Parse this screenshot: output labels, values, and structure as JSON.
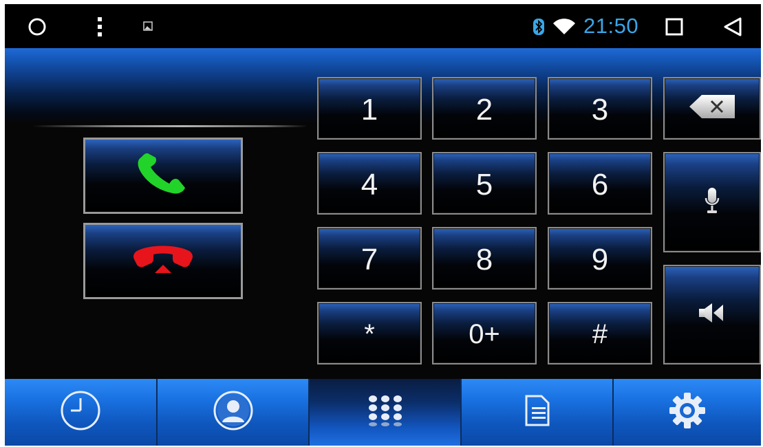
{
  "status_bar": {
    "clock": "21:50",
    "clock_color": "#3aa6e8",
    "left_icons": [
      "home-circle-icon",
      "overflow-menu-icon",
      "image-notification-icon"
    ],
    "right_icons": [
      "bluetooth-icon",
      "wifi-icon",
      "recents-square-icon",
      "back-triangle-icon"
    ]
  },
  "call_controls": {
    "answer_icon": "phone-answer-icon",
    "answer_color": "#22d32a",
    "hangup_icon": "phone-hangup-icon",
    "hangup_color": "#e8141b"
  },
  "keypad": {
    "keys": [
      "1",
      "2",
      "3",
      "4",
      "5",
      "6",
      "7",
      "8",
      "9",
      "*",
      "0+",
      "#"
    ]
  },
  "side_keys": {
    "backspace_icon": "backspace-icon",
    "mic_icon": "microphone-icon",
    "audio_icon": "speaker-transfer-icon"
  },
  "nav_tabs": [
    {
      "name": "call-log",
      "icon": "clock-icon",
      "active": false
    },
    {
      "name": "contacts",
      "icon": "contact-person-icon",
      "active": false
    },
    {
      "name": "dialpad",
      "icon": "dialpad-grid-icon",
      "active": true
    },
    {
      "name": "sms",
      "icon": "document-icon",
      "active": false
    },
    {
      "name": "settings",
      "icon": "gear-icon",
      "active": false
    }
  ]
}
